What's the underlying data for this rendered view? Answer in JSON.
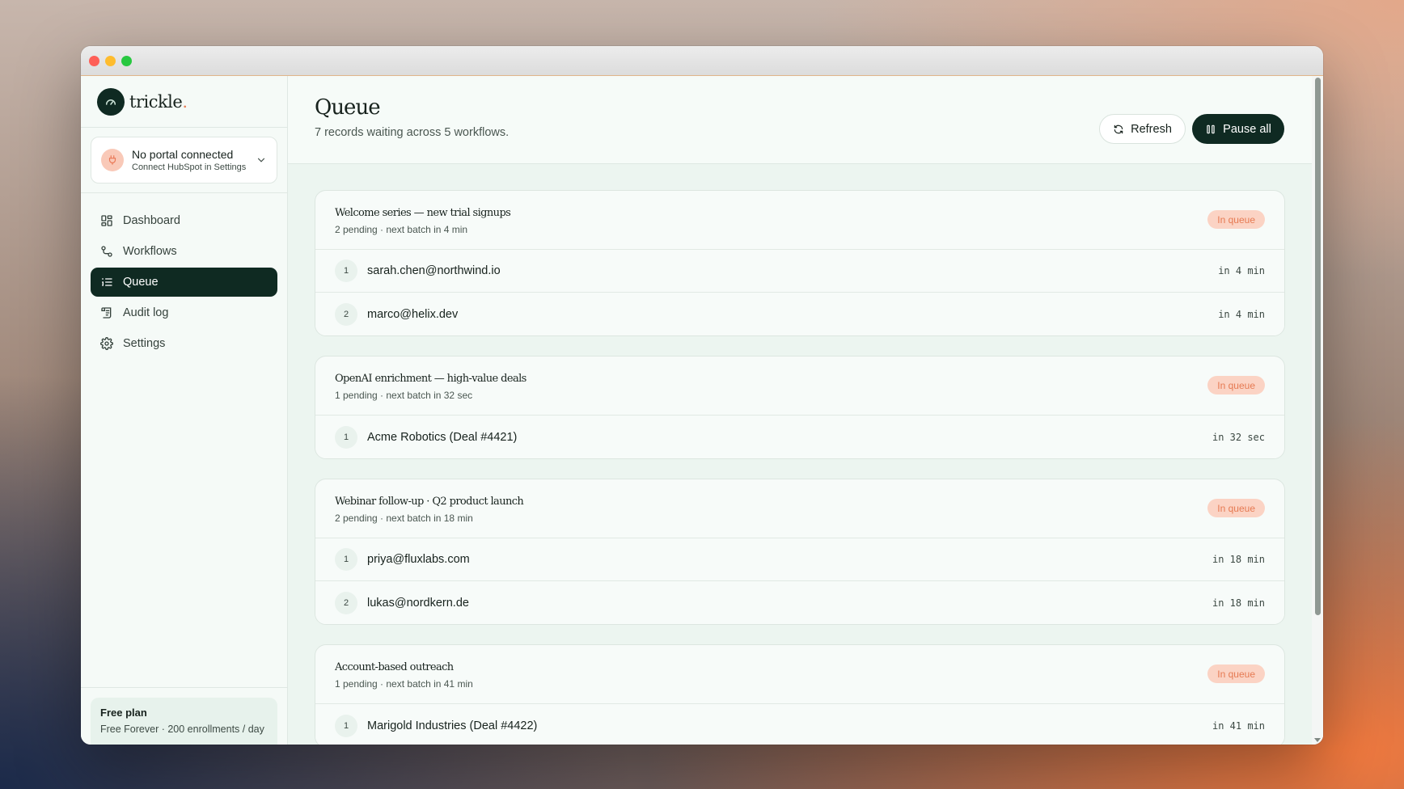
{
  "brand": {
    "name": "trickle",
    "dot": "."
  },
  "portal": {
    "title": "No portal connected",
    "subtitle": "Connect HubSpot in Settings"
  },
  "nav": [
    {
      "label": "Dashboard",
      "icon": "dashboard-icon",
      "active": false
    },
    {
      "label": "Workflows",
      "icon": "workflows-icon",
      "active": false
    },
    {
      "label": "Queue",
      "icon": "queue-icon",
      "active": true
    },
    {
      "label": "Audit log",
      "icon": "audit-log-icon",
      "active": false
    },
    {
      "label": "Settings",
      "icon": "gear-icon",
      "active": false
    }
  ],
  "plan": {
    "title": "Free plan",
    "subtitle": "Free Forever · 200 enrollments / day"
  },
  "header": {
    "title": "Queue",
    "subtitle": "7 records waiting across 5 workflows.",
    "refresh_label": "Refresh",
    "pause_label": "Pause all"
  },
  "groups": [
    {
      "title": "Welcome series — new trial signups",
      "meta": "2 pending · next batch in 4 min",
      "badge": "In queue",
      "rows": [
        {
          "num": "1",
          "name": "sarah.chen@northwind.io",
          "time": "in 4 min"
        },
        {
          "num": "2",
          "name": "marco@helix.dev",
          "time": "in 4 min"
        }
      ]
    },
    {
      "title": "OpenAI enrichment — high-value deals",
      "meta": "1 pending · next batch in 32 sec",
      "badge": "In queue",
      "rows": [
        {
          "num": "1",
          "name": "Acme Robotics (Deal #4421)",
          "time": "in 32 sec"
        }
      ]
    },
    {
      "title": "Webinar follow-up · Q2 product launch",
      "meta": "2 pending · next batch in 18 min",
      "badge": "In queue",
      "rows": [
        {
          "num": "1",
          "name": "priya@fluxlabs.com",
          "time": "in 18 min"
        },
        {
          "num": "2",
          "name": "lukas@nordkern.de",
          "time": "in 18 min"
        }
      ]
    },
    {
      "title": "Account-based outreach",
      "meta": "1 pending · next batch in 41 min",
      "badge": "In queue",
      "rows": [
        {
          "num": "1",
          "name": "Marigold Industries (Deal #4422)",
          "time": "in 41 min"
        }
      ]
    }
  ],
  "colors": {
    "accent_dark": "#0f2a22",
    "badge_bg": "#fbd3c4",
    "badge_text": "#e67a52",
    "background": "#ecf5f0"
  }
}
